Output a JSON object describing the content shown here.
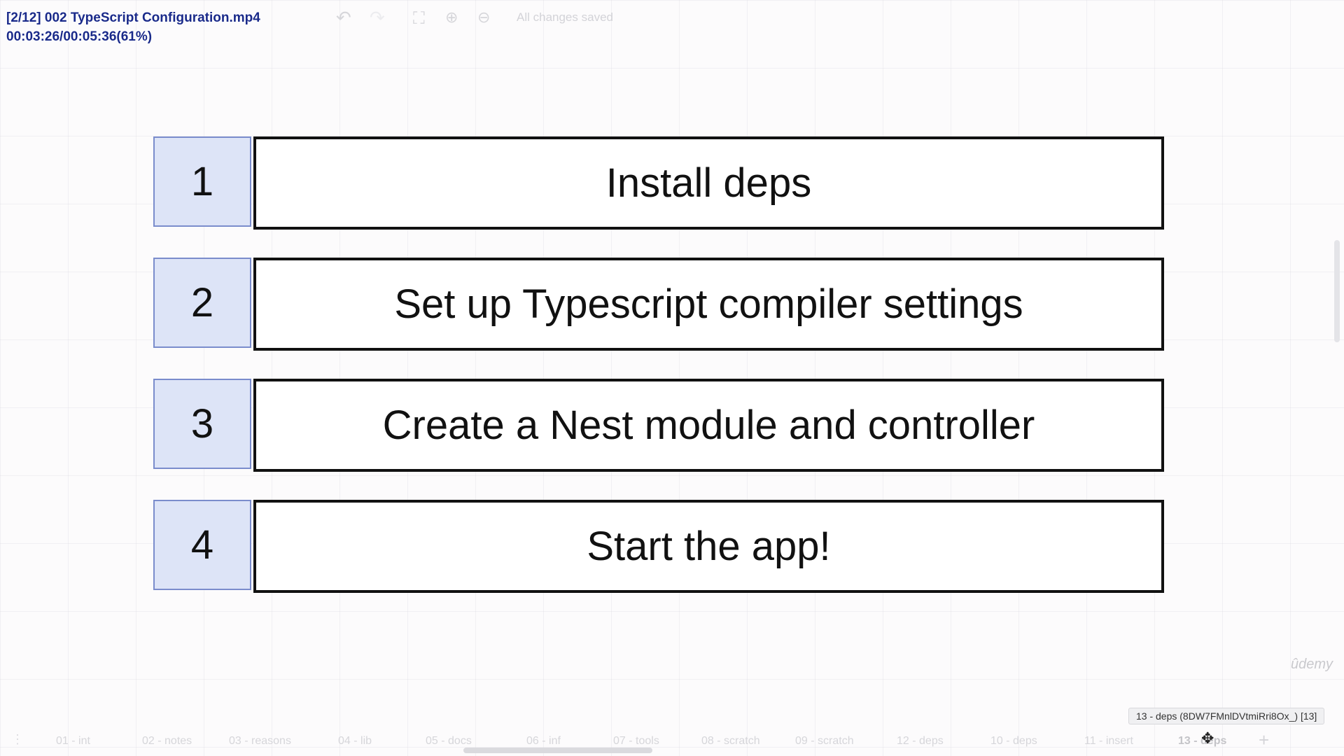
{
  "overlay": {
    "title": "[2/12] 002 TypeScript Configuration.mp4",
    "progress": "00:03:26/00:05:36(61%)"
  },
  "toolbar": {
    "status": "All changes saved",
    "icons": [
      "undo-icon",
      "redo-icon",
      "fullscreen-icon",
      "zoom-in-icon",
      "zoom-out-icon"
    ]
  },
  "steps": [
    {
      "num": "1",
      "label": "Install deps"
    },
    {
      "num": "2",
      "label": "Set up Typescript compiler settings"
    },
    {
      "num": "3",
      "label": "Create a Nest module and controller"
    },
    {
      "num": "4",
      "label": "Start the app!"
    }
  ],
  "watermark": "ûdemy",
  "tooltip": "13 - deps (8DW7FMnlDVtmiRri8Ox_) [13]",
  "tabs": [
    "01 - int",
    "02 - notes",
    "03 - reasons",
    "04 - lib",
    "05 - docs",
    "06 - inf",
    "07 - tools",
    "08 - scratch",
    "09 - scratch",
    "12 - deps",
    "10 - deps",
    "11 - insert",
    "13 - deps"
  ],
  "colors": {
    "step_number_fill": "#dde4f7",
    "step_number_border": "#7a8ccc",
    "overlay_text": "#1a2a8a"
  }
}
